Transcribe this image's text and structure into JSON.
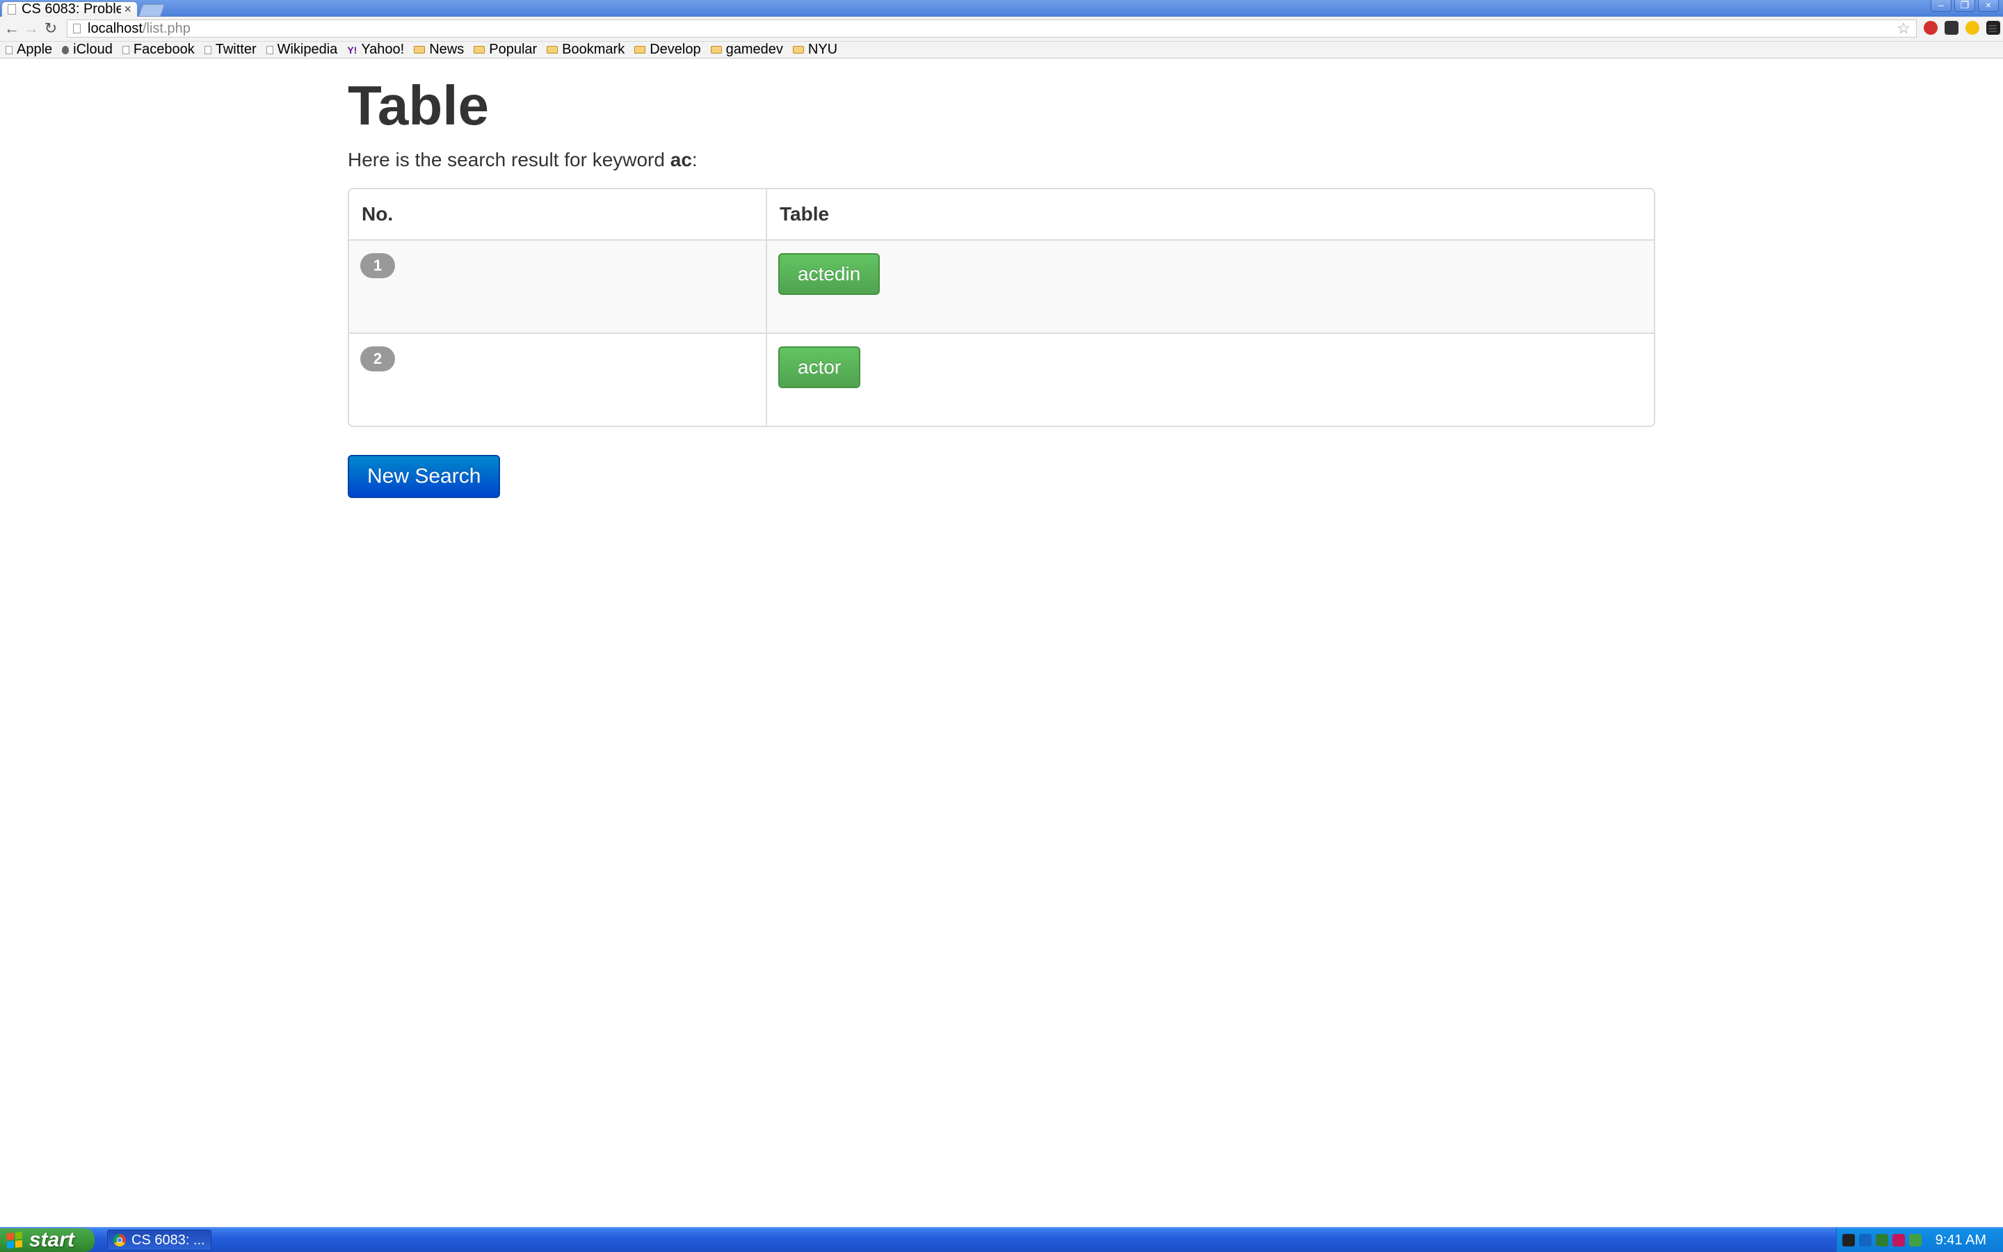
{
  "browser": {
    "tab_title": "CS 6083: Proble",
    "tab_close": "×",
    "url_host": "localhost",
    "url_path": "/list.php",
    "bookmarks": [
      {
        "label": "Apple",
        "icon": "page-icon"
      },
      {
        "label": "iCloud",
        "icon": "apple-icon"
      },
      {
        "label": "Facebook",
        "icon": "page-icon"
      },
      {
        "label": "Twitter",
        "icon": "page-icon"
      },
      {
        "label": "Wikipedia",
        "icon": "page-icon"
      },
      {
        "label": "Yahoo!",
        "icon": "yahoo-icon"
      },
      {
        "label": "News",
        "icon": "folder-icon"
      },
      {
        "label": "Popular",
        "icon": "folder-icon"
      },
      {
        "label": "Bookmark",
        "icon": "folder-icon"
      },
      {
        "label": "Develop",
        "icon": "folder-icon"
      },
      {
        "label": "gamedev",
        "icon": "folder-icon"
      },
      {
        "label": "NYU",
        "icon": "folder-icon"
      }
    ]
  },
  "page": {
    "title": "Table",
    "summary_prefix": "Here is the search result for keyword ",
    "keyword": "ac",
    "summary_suffix": ":",
    "table": {
      "headers": [
        "No.",
        "Table"
      ],
      "rows": [
        {
          "no": "1",
          "table": "actedin"
        },
        {
          "no": "2",
          "table": "actor"
        }
      ]
    },
    "new_search_label": "New Search"
  },
  "taskbar": {
    "start_label": "start",
    "task_label": "CS 6083: ...",
    "clock": "9:41 AM"
  },
  "colors": {
    "success_button": "#5bb75b",
    "primary_button": "#0066cc",
    "badge": "#999999"
  }
}
